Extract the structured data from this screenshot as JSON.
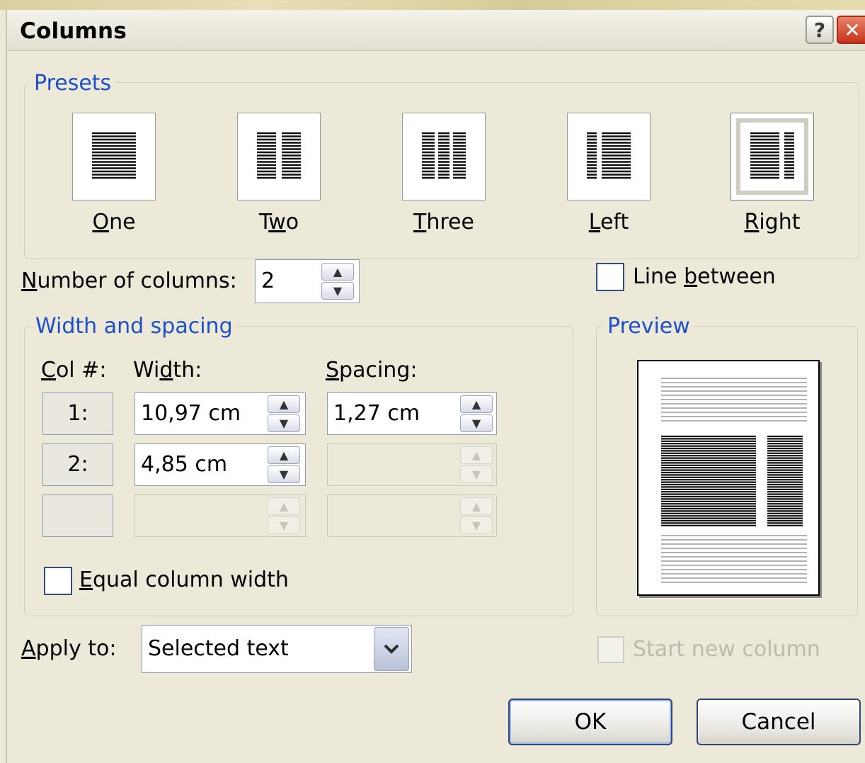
{
  "dialog": {
    "title": "Columns",
    "help_icon": "question-mark-icon",
    "close_icon": "close-x-icon",
    "help_glyph": "?",
    "close_glyph": "✕"
  },
  "presets": {
    "legend": "Presets",
    "items": [
      {
        "label_pre": "",
        "label_u": "O",
        "label_post": "ne",
        "selected": false
      },
      {
        "label_pre": "T",
        "label_u": "w",
        "label_post": "o",
        "selected": false
      },
      {
        "label_pre": "",
        "label_u": "T",
        "label_post": "hree",
        "selected": false
      },
      {
        "label_pre": "",
        "label_u": "L",
        "label_post": "eft",
        "selected": false
      },
      {
        "label_pre": "",
        "label_u": "R",
        "label_post": "ight",
        "selected": true
      }
    ]
  },
  "number_of_columns": {
    "label_u": "N",
    "label_rest": "umber of columns:",
    "value": "2"
  },
  "line_between": {
    "label_pre": "Line ",
    "label_u": "b",
    "label_post": "etween",
    "checked": false
  },
  "width_spacing": {
    "legend": "Width and spacing",
    "col_header_u": "C",
    "col_header_rest": "ol #:",
    "width_header_pre": "Wi",
    "width_header_u": "d",
    "width_header_post": "th:",
    "spacing_header_u": "S",
    "spacing_header_rest": "pacing:",
    "rows": [
      {
        "col": "1:",
        "width": "10,97 cm",
        "spacing": "1,27 cm",
        "width_enabled": true,
        "spacing_enabled": true
      },
      {
        "col": "2:",
        "width": "4,85 cm",
        "spacing": "",
        "width_enabled": true,
        "spacing_enabled": false
      },
      {
        "col": "",
        "width": "",
        "spacing": "",
        "width_enabled": false,
        "spacing_enabled": false
      }
    ]
  },
  "equal_column_width": {
    "label_u": "E",
    "label_rest": "qual column width",
    "checked": false
  },
  "preview": {
    "legend": "Preview"
  },
  "apply_to": {
    "label_u": "A",
    "label_rest": "pply to:",
    "value": "Selected text",
    "dropdown_icon": "chevron-down-icon"
  },
  "start_new_column": {
    "label": "Start new column",
    "enabled": false
  },
  "buttons": {
    "ok": "OK",
    "cancel": "Cancel"
  },
  "spin_glyphs": {
    "up": "▲",
    "down": "▼"
  },
  "dropdown_glyph": "⌄"
}
